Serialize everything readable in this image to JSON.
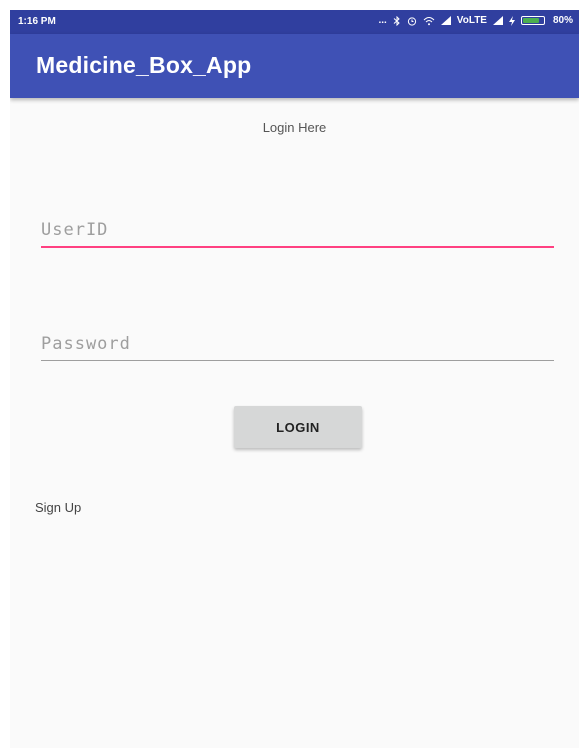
{
  "status_bar": {
    "time": "1:16 PM",
    "dots": "...",
    "icons": [
      "bluetooth-icon",
      "alarm-icon",
      "wifi-icon",
      "signal-icon",
      "signal-icon",
      "charging-icon",
      "battery-icon"
    ],
    "network": "VoLTE",
    "battery_percent": "80%",
    "battery_level": 0.8,
    "battery_color": "#4caf50"
  },
  "app_bar": {
    "title": "Medicine_Box_App",
    "color": "#3f51b5"
  },
  "form": {
    "heading": "Login Here",
    "userid_placeholder": "UserID",
    "userid_value": "",
    "password_placeholder": "Password",
    "password_value": "",
    "focus_color": "#ff4081",
    "login_label": "LOGIN"
  },
  "signup": {
    "label": "Sign Up"
  }
}
